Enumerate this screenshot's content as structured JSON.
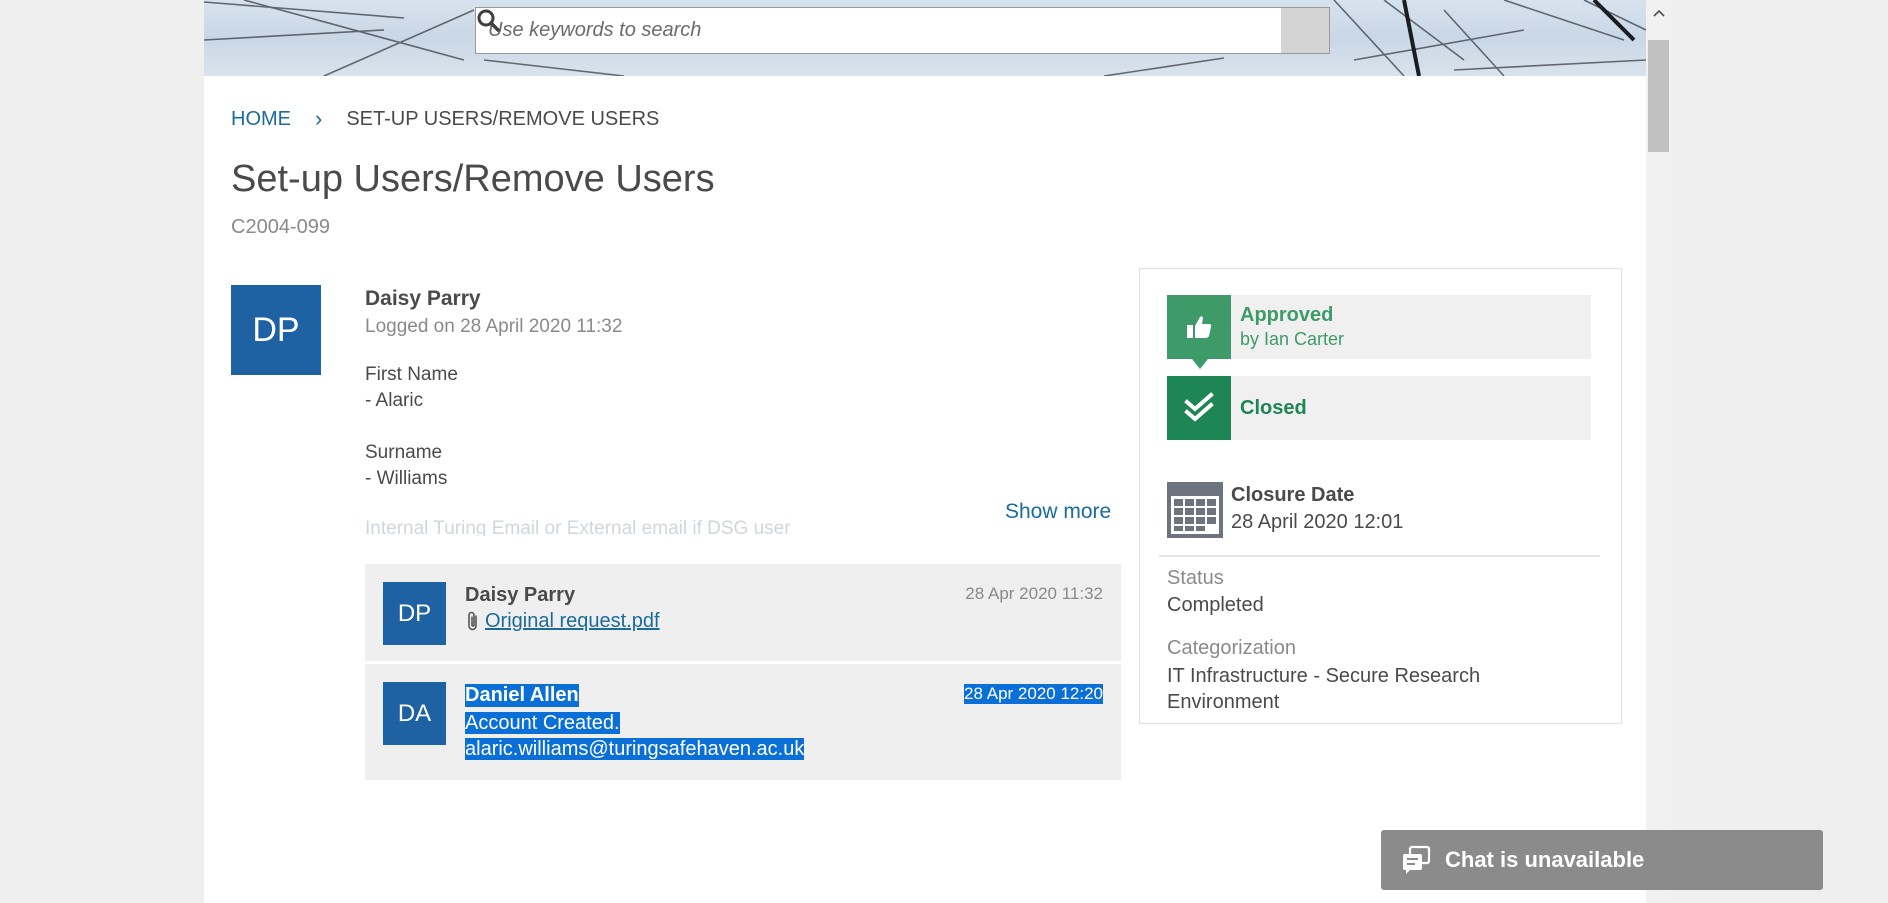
{
  "search": {
    "placeholder": "Use keywords to search"
  },
  "breadcrumb": {
    "home": "HOME",
    "separator": "›",
    "current": "SET-UP USERS/REMOVE USERS"
  },
  "page": {
    "title": "Set-up Users/Remove Users",
    "ticket_id": "C2004-099"
  },
  "request": {
    "avatar_initials": "DP",
    "author": "Daisy Parry",
    "logged": "Logged on 28 April 2020 11:32",
    "fields": [
      {
        "label": "First Name",
        "value": "- Alaric"
      },
      {
        "label": "Surname",
        "value": "- Williams"
      }
    ],
    "faded_line": "Internal Turing Email or External email if DSG user",
    "show_more": "Show more"
  },
  "feed": [
    {
      "initials": "DP",
      "name": "Daisy Parry",
      "date": "28 Apr 2020 11:32",
      "attachment": "Original request.pdf"
    },
    {
      "initials": "DA",
      "name": "Daniel Allen",
      "date": "28 Apr 2020 12:20",
      "lines": [
        "Account Created.",
        "alaric.williams@turingsafehaven.ac.uk"
      ]
    }
  ],
  "status_panel": {
    "approved": {
      "label": "Approved",
      "by": "by Ian Carter"
    },
    "closed": {
      "label": "Closed"
    },
    "closure": {
      "label": "Closure Date",
      "date": "28 April 2020 12:01"
    },
    "status": {
      "label": "Status",
      "value": "Completed"
    },
    "categorization": {
      "label": "Categorization",
      "value": "IT Infrastructure - Secure Research Environment"
    }
  },
  "chat": {
    "label": "Chat is unavailable"
  },
  "colors": {
    "accent": "#1b6b9b",
    "avatar": "#1f62a3",
    "approved": "#3e9b69",
    "closed": "#1e8554",
    "selection": "#0a6fd6"
  }
}
